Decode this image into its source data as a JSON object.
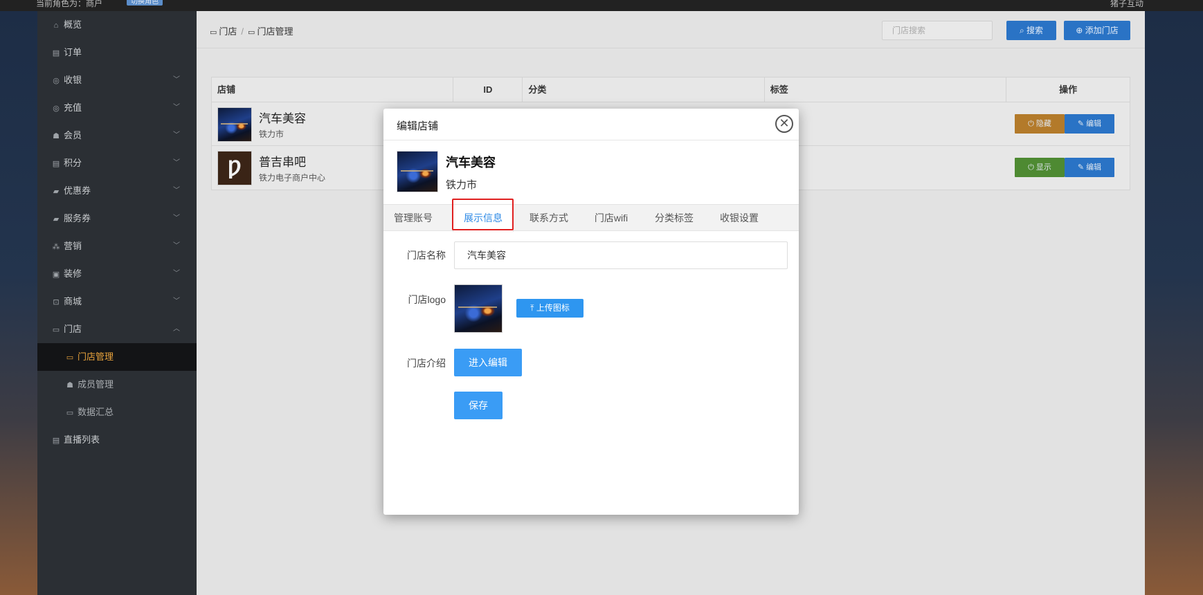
{
  "topbar": {
    "role": "当前角色为：商户",
    "badge": "切换角色",
    "user": "猪子互动"
  },
  "sidebar": {
    "items": [
      {
        "label": "概览",
        "icon": "home-icon",
        "chevron": ""
      },
      {
        "label": "订单",
        "icon": "order-icon",
        "chevron": ""
      },
      {
        "label": "收银",
        "icon": "cashier-icon",
        "chevron": "﹀"
      },
      {
        "label": "充值",
        "icon": "recharge-icon",
        "chevron": "﹀"
      },
      {
        "label": "会员",
        "icon": "member-icon",
        "chevron": "﹀"
      },
      {
        "label": "积分",
        "icon": "points-icon",
        "chevron": "﹀"
      },
      {
        "label": "优惠券",
        "icon": "coupon-icon",
        "chevron": "﹀"
      },
      {
        "label": "服务券",
        "icon": "service-coupon-icon",
        "chevron": "﹀"
      },
      {
        "label": "营销",
        "icon": "marketing-icon",
        "chevron": "﹀"
      },
      {
        "label": "装修",
        "icon": "decor-icon",
        "chevron": "﹀"
      },
      {
        "label": "商城",
        "icon": "mall-icon",
        "chevron": "﹀"
      },
      {
        "label": "门店",
        "icon": "store-icon",
        "chevron": "︿"
      },
      {
        "label": "门店管理",
        "icon": "store-manage-icon",
        "chevron": ""
      },
      {
        "label": "成员管理",
        "icon": "members-icon",
        "chevron": ""
      },
      {
        "label": "数据汇总",
        "icon": "data-icon",
        "chevron": ""
      },
      {
        "label": "直播列表",
        "icon": "live-icon",
        "chevron": ""
      }
    ]
  },
  "breadcrumb": {
    "root": "门店",
    "current": "门店管理"
  },
  "search": {
    "placeholder": "门店搜索",
    "button": "搜索"
  },
  "add_button": "添加门店",
  "table": {
    "headers": [
      "店铺",
      "ID",
      "分类",
      "标签",
      "操作"
    ],
    "rows": [
      {
        "name": "汽车美容",
        "address": "铁力市",
        "toggle": "隐藏",
        "edit": "编辑"
      },
      {
        "name": "普吉串吧",
        "address": "铁力电子商户中心",
        "toggle": "显示",
        "edit": "编辑"
      }
    ]
  },
  "modal": {
    "title": "编辑店铺",
    "close": "✕",
    "store_name": "汽车美容",
    "store_address": "铁力市",
    "tabs": [
      "管理账号",
      "展示信息",
      "联系方式",
      "门店wifi",
      "分类标签",
      "收银设置"
    ],
    "active_tab": "展示信息",
    "form": {
      "name_label": "门店名称",
      "name_value": "汽车美容",
      "logo_label": "门店logo",
      "upload_button": "上传图标",
      "intro_label": "门店介绍",
      "intro_button": "进入编辑",
      "save_button": "保存"
    }
  },
  "colors": {
    "accent": "#2e96f0",
    "active_menu": "#e9a33c",
    "highlight": "#e02020"
  }
}
